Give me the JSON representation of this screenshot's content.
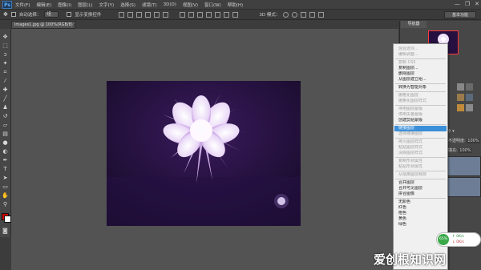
{
  "app": {
    "logo": "Ps"
  },
  "menubar": {
    "items": [
      "文件(F)",
      "编辑(E)",
      "图像(I)",
      "图层(L)",
      "文字(Y)",
      "选择(S)",
      "滤镜(T)",
      "3D(D)",
      "视图(V)",
      "窗口(W)",
      "帮助(H)"
    ],
    "window_controls": [
      "—",
      "❐",
      "✕"
    ]
  },
  "optionsbar": {
    "auto_select_label": "自动选择：",
    "auto_select_value": "组",
    "show_transform_label": "显示变换控件",
    "mode_3d_label": "3D 模式：",
    "workspace": "基本功能"
  },
  "document": {
    "tab_title": "images1.jpg @ 100%(RGB/8) *"
  },
  "right_panel": {
    "navigator_tab": "导航器",
    "opacity_label": "不透明度:",
    "opacity_value": "100%",
    "fill_label": "填充:",
    "fill_value": "100%"
  },
  "context_menu": {
    "items": [
      {
        "label": "混合选项...",
        "state": "disabled"
      },
      {
        "label": "编辑调整...",
        "state": "disabled"
      },
      {
        "sep": true
      },
      {
        "label": "复制 CSS",
        "state": "disabled"
      },
      {
        "label": "复制图层...",
        "state": "normal"
      },
      {
        "label": "删除图层",
        "state": "normal"
      },
      {
        "label": "从图层建立组...",
        "state": "normal"
      },
      {
        "sep": true
      },
      {
        "label": "转换为智能对象",
        "state": "normal"
      },
      {
        "sep": true
      },
      {
        "label": "栅格化图层",
        "state": "disabled"
      },
      {
        "label": "栅格化图层样式",
        "state": "disabled"
      },
      {
        "sep": true
      },
      {
        "label": "停用图层蒙版",
        "state": "disabled"
      },
      {
        "label": "停用矢量蒙版",
        "state": "disabled"
      },
      {
        "label": "创建剪贴蒙版",
        "state": "normal"
      },
      {
        "sep": true
      },
      {
        "label": "链接图层",
        "state": "selected"
      },
      {
        "label": "选择链接图层",
        "state": "disabled"
      },
      {
        "sep": true
      },
      {
        "label": "拷贝图层样式",
        "state": "disabled"
      },
      {
        "label": "粘贴图层样式",
        "state": "disabled"
      },
      {
        "label": "清除图层样式",
        "state": "disabled"
      },
      {
        "sep": true
      },
      {
        "label": "复制形状属性",
        "state": "disabled"
      },
      {
        "label": "粘贴形状属性",
        "state": "disabled"
      },
      {
        "sep": true
      },
      {
        "label": "从隔离图层释放",
        "state": "disabled"
      },
      {
        "sep": true
      },
      {
        "label": "合并图层",
        "state": "normal"
      },
      {
        "label": "合并可见图层",
        "state": "normal"
      },
      {
        "label": "拼合图像",
        "state": "normal"
      },
      {
        "sep": true
      },
      {
        "label": "无颜色",
        "state": "normal"
      },
      {
        "label": "红色",
        "state": "normal"
      },
      {
        "label": "橙色",
        "state": "normal"
      },
      {
        "label": "黄色",
        "state": "normal"
      },
      {
        "label": "绿色",
        "state": "normal"
      }
    ]
  },
  "speed_badge": {
    "percent": "65%",
    "line1": "0K/s",
    "line2": "0K/s"
  },
  "watermark": {
    "text": "爱创根知识网"
  },
  "colors": {
    "foreground": "#d40000",
    "background": "#ffffff",
    "menu_highlight": "#3b8fd9",
    "accent_logo": "#5fb3ff"
  }
}
